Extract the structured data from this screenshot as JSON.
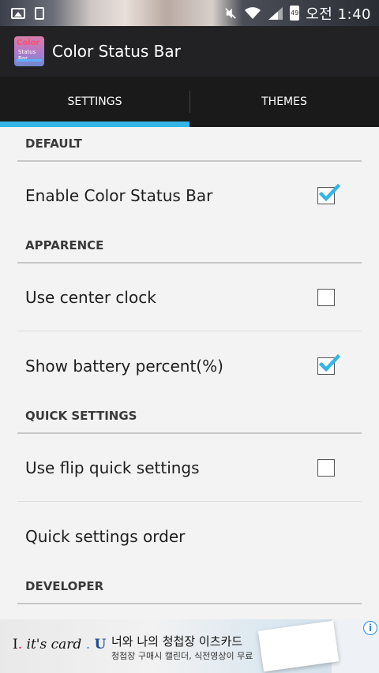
{
  "status_bar": {
    "battery_level": "49",
    "time": "오전 1:40",
    "icons": [
      "image-icon",
      "download-icon",
      "mute-icon",
      "wifi-icon",
      "signal-icon",
      "battery-icon"
    ]
  },
  "app": {
    "title": "Color Status Bar",
    "icon_text_top": "Color",
    "icon_text_bottom": "Status Bar"
  },
  "tabs": [
    {
      "label": "SETTINGS",
      "active": true
    },
    {
      "label": "THEMES",
      "active": false
    }
  ],
  "sections": {
    "default": {
      "header": "DEFAULT",
      "items": [
        {
          "label": "Enable Color Status Bar",
          "checked": true
        }
      ]
    },
    "appearance": {
      "header": "APPARENCE",
      "items": [
        {
          "label": "Use center clock",
          "checked": false
        },
        {
          "label": "Show battery percent(%)",
          "checked": true
        }
      ]
    },
    "quick_settings": {
      "header": "QUICK SETTINGS",
      "items": [
        {
          "label": "Use flip quick settings",
          "checked": false
        },
        {
          "label": "Quick settings order"
        }
      ]
    },
    "developer": {
      "header": "DEVELOPER"
    }
  },
  "ad": {
    "brand_i": "I",
    "brand_dot": ".",
    "brand_card": "it's card",
    "brand_dot2": ".",
    "brand_u": "U",
    "title": "너와 나의 청첩장 이츠카드",
    "subtitle": "청첩장 구매시 캘린더, 식전영상이 무료",
    "info": "i"
  },
  "colors": {
    "accent": "#33b5e5",
    "action_bar": "#222224",
    "tab_bar": "#1a1a1a",
    "background": "#f3f3f3"
  }
}
